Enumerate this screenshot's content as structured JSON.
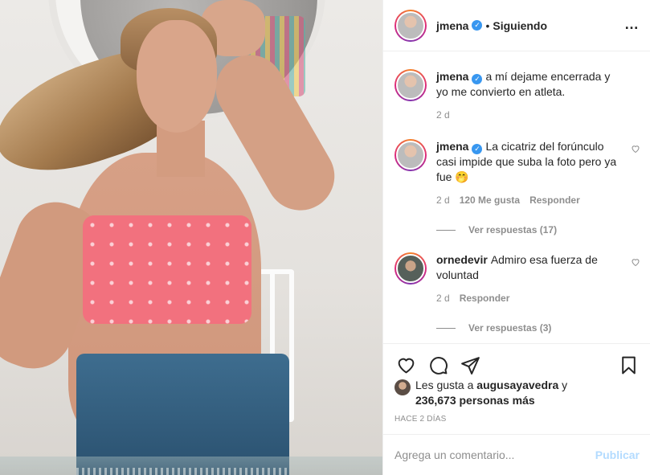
{
  "header": {
    "username": "jmena",
    "separator": "•",
    "follow_status": "Siguiendo",
    "more_icon": "…"
  },
  "caption": {
    "username": "jmena",
    "text": "a mí dejame encerrada y yo me convierto en atleta.",
    "time": "2 d"
  },
  "comments": [
    {
      "username": "jmena",
      "text": "La cicatriz del forúnculo casi impide que suba la foto pero ya fue 🤭",
      "time": "2 d",
      "likes": "120 Me gusta",
      "reply": "Responder",
      "view_replies": "Ver respuestas (17)"
    },
    {
      "username": "ornedevir",
      "text": "Admiro esa fuerza de voluntad",
      "time": "2 d",
      "reply": "Responder",
      "view_replies": "Ver respuestas (3)"
    }
  ],
  "likes": {
    "prefix": "Les gusta a",
    "user": "augusayavedra",
    "conj": "y",
    "count": "236,673 personas más"
  },
  "timestamp": "HACE 2 DÍAS",
  "add_comment": {
    "placeholder": "Agrega un comentario...",
    "publish": "Publicar"
  },
  "icons": {
    "like": "heart-icon",
    "comment": "comment-icon",
    "share": "paper-plane-icon",
    "save": "bookmark-icon",
    "verified": "verified-badge-icon",
    "verified_glyph": "✓"
  },
  "colors": {
    "text": "#262626",
    "secondary": "#8e8e8e",
    "verified": "#3897f0",
    "publish_disabled": "#b3dbff",
    "border": "#efefef"
  }
}
